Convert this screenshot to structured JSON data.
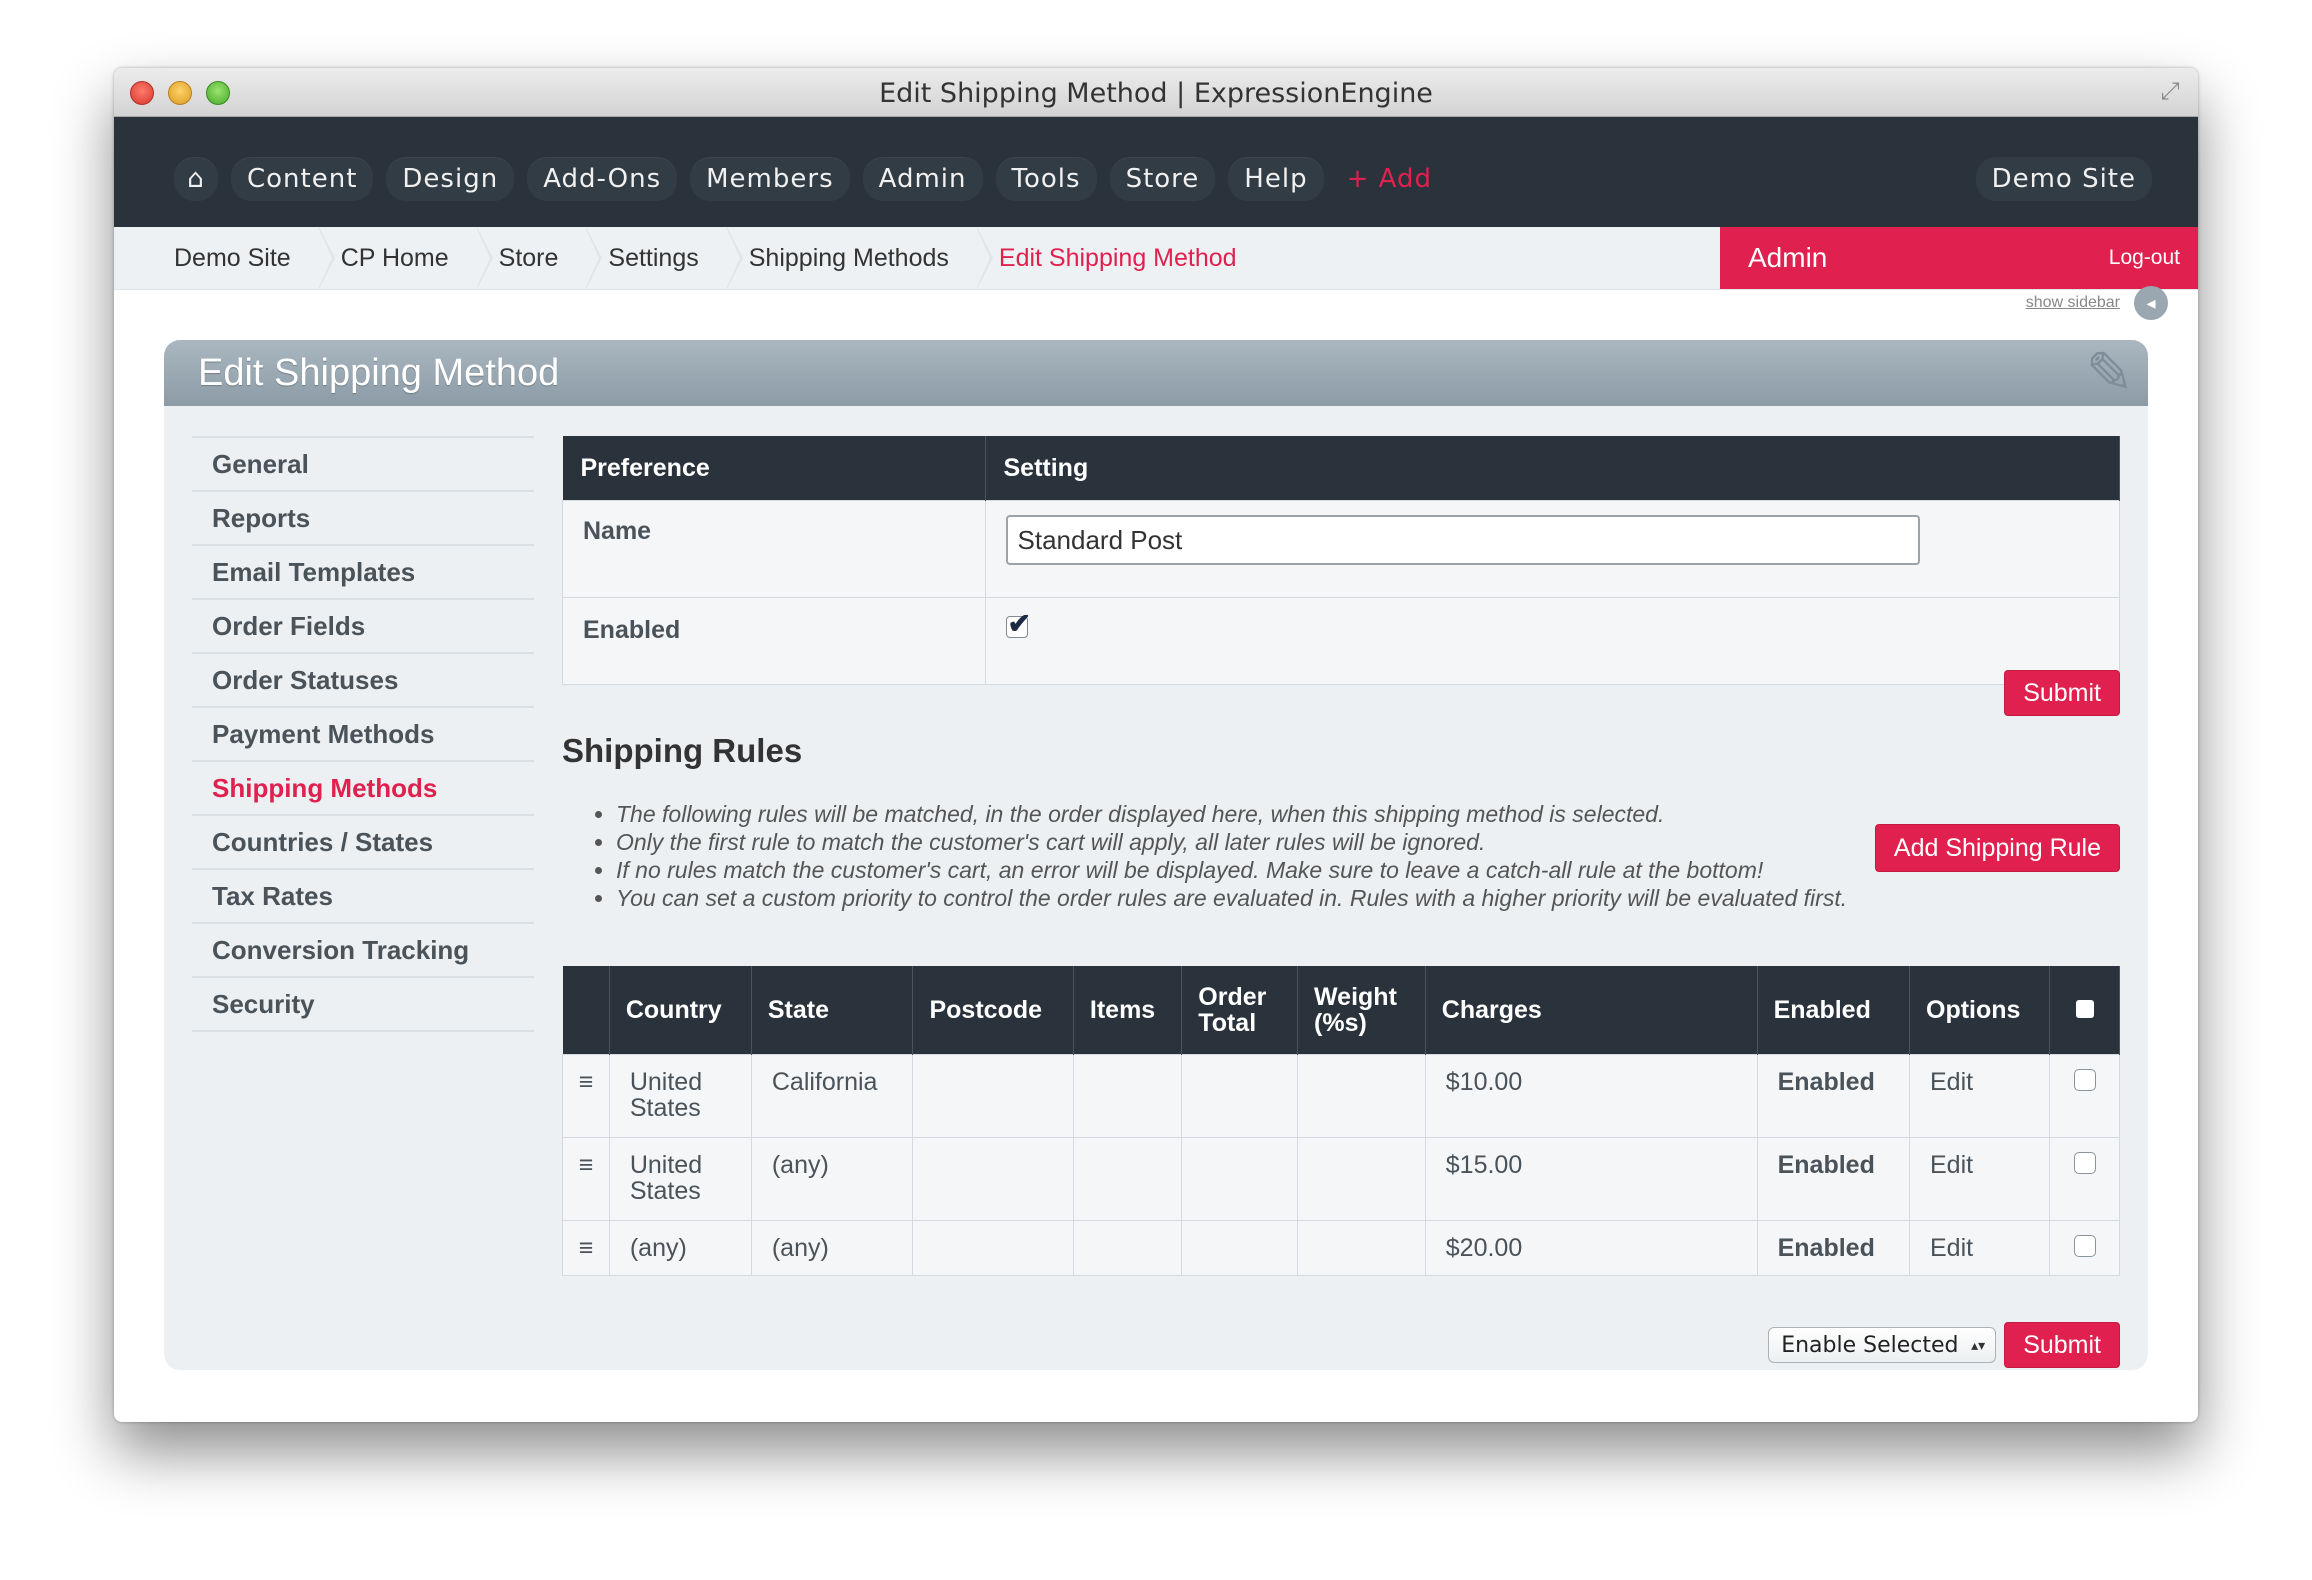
{
  "window": {
    "title": "Edit Shipping Method | ExpressionEngine"
  },
  "nav": {
    "home_icon": "home-icon",
    "items": [
      "Content",
      "Design",
      "Add-Ons",
      "Members",
      "Admin",
      "Tools",
      "Store",
      "Help"
    ],
    "add_label": "+ Add",
    "site_label": "Demo Site"
  },
  "breadcrumb": {
    "items": [
      "Demo Site",
      "CP Home",
      "Store",
      "Settings",
      "Shipping Methods"
    ],
    "current": "Edit Shipping Method"
  },
  "user": {
    "name": "Admin",
    "logout": "Log-out"
  },
  "sidebar_toggle": {
    "label": "show sidebar"
  },
  "panel": {
    "title": "Edit Shipping Method"
  },
  "side_menu": {
    "items": [
      "General",
      "Reports",
      "Email Templates",
      "Order Fields",
      "Order Statuses",
      "Payment Methods",
      "Shipping Methods",
      "Countries / States",
      "Tax Rates",
      "Conversion Tracking",
      "Security"
    ],
    "active": "Shipping Methods"
  },
  "preferences": {
    "headers": [
      "Preference",
      "Setting"
    ],
    "name_label": "Name",
    "name_value": "Standard Post",
    "enabled_label": "Enabled",
    "enabled_checked": true,
    "submit_label": "Submit"
  },
  "shipping_rules": {
    "heading": "Shipping Rules",
    "notes": [
      "The following rules will be matched, in the order displayed here, when this shipping method is selected.",
      "Only the first rule to match the customer's cart will apply, all later rules will be ignored.",
      "If no rules match the customer's cart, an error will be displayed. Make sure to leave a catch-all rule at the bottom!",
      "You can set a custom priority to control the order rules are evaluated in. Rules with a higher priority will be evaluated first."
    ],
    "add_button": "Add Shipping Rule",
    "columns": [
      "Country",
      "State",
      "Postcode",
      "Items",
      "Order Total",
      "Weight (%s)",
      "Charges",
      "Enabled",
      "Options"
    ],
    "rows": [
      {
        "country": "United States",
        "state": "California",
        "postcode": "",
        "items": "",
        "order_total": "",
        "weight": "",
        "charges": "$10.00",
        "enabled": "Enabled",
        "option": "Edit"
      },
      {
        "country": "United States",
        "state": "(any)",
        "postcode": "",
        "items": "",
        "order_total": "",
        "weight": "",
        "charges": "$15.00",
        "enabled": "Enabled",
        "option": "Edit"
      },
      {
        "country": "(any)",
        "state": "(any)",
        "postcode": "",
        "items": "",
        "order_total": "",
        "weight": "",
        "charges": "$20.00",
        "enabled": "Enabled",
        "option": "Edit"
      }
    ],
    "bulk_action": "Enable Selected",
    "submit_label": "Submit"
  },
  "colors": {
    "accent": "#e0204e",
    "nav_bg": "#2a333b",
    "enabled_green": "#1c7a1c"
  }
}
